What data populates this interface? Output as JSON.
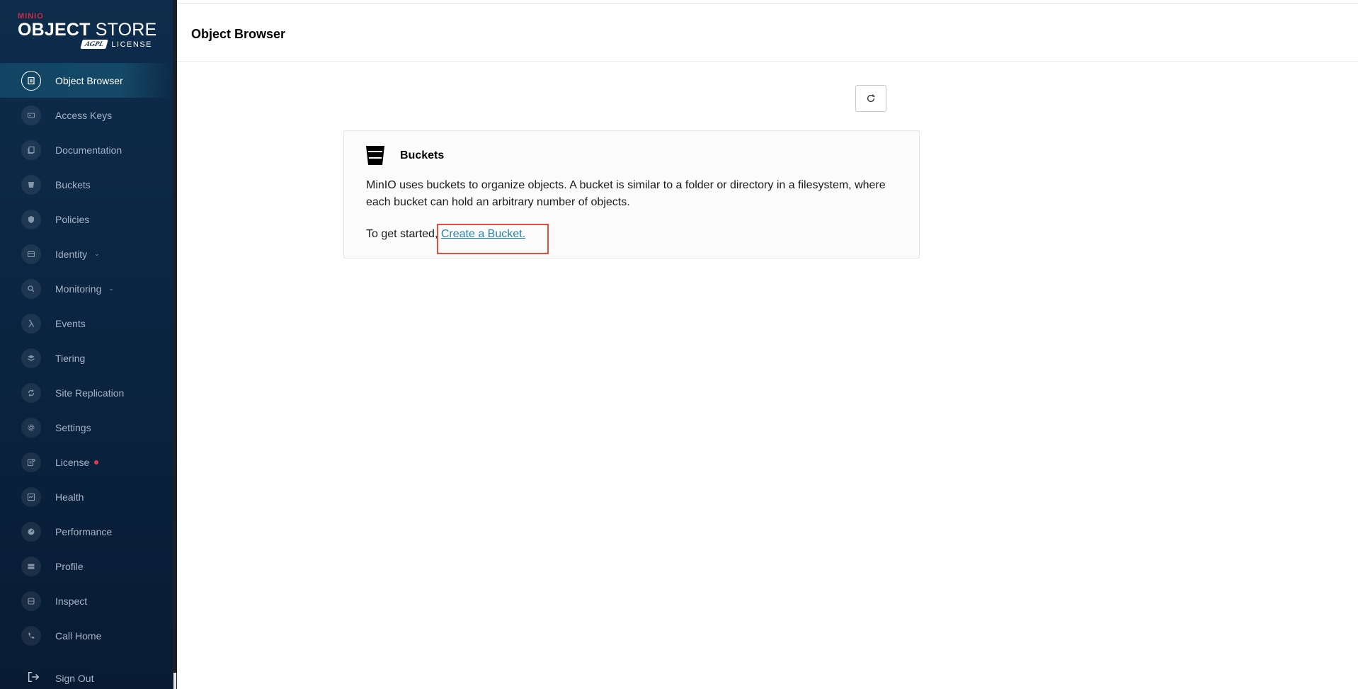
{
  "logo": {
    "brand": "MINIO",
    "product_bold": "OBJECT",
    "product_light": "STORE",
    "agpl": "AGPL",
    "license": "LICENSE"
  },
  "sidebar": {
    "items": [
      {
        "label": "Object Browser",
        "icon": "object-browser-icon",
        "active": true
      },
      {
        "label": "Access Keys",
        "icon": "access-keys-icon"
      },
      {
        "label": "Documentation",
        "icon": "documentation-icon"
      },
      {
        "label": "Buckets",
        "icon": "buckets-icon"
      },
      {
        "label": "Policies",
        "icon": "policies-icon"
      },
      {
        "label": "Identity",
        "icon": "identity-icon",
        "chevron": true
      },
      {
        "label": "Monitoring",
        "icon": "monitoring-icon",
        "chevron": true
      },
      {
        "label": "Events",
        "icon": "lambda-icon"
      },
      {
        "label": "Tiering",
        "icon": "tiering-icon"
      },
      {
        "label": "Site Replication",
        "icon": "site-replication-icon"
      },
      {
        "label": "Settings",
        "icon": "gear-icon"
      },
      {
        "label": "License",
        "icon": "license-icon",
        "badge": true
      },
      {
        "label": "Health",
        "icon": "health-icon"
      },
      {
        "label": "Performance",
        "icon": "performance-icon"
      },
      {
        "label": "Profile",
        "icon": "profile-icon"
      },
      {
        "label": "Inspect",
        "icon": "inspect-icon"
      },
      {
        "label": "Call Home",
        "icon": "phone-icon"
      }
    ],
    "sign_out": "Sign Out"
  },
  "header": {
    "title": "Object Browser"
  },
  "card": {
    "title": "Buckets",
    "description": "MinIO uses buckets to organize objects. A bucket is similar to a folder or directory in a filesystem, where each bucket can hold an arbitrary number of objects.",
    "start_prefix": "To get started, ",
    "link": "Create a Bucket."
  },
  "colors": {
    "sidebar_bg": "#0d2c4b",
    "link": "#2781b0",
    "badge": "#e8344e",
    "highlight": "#e74c3c"
  }
}
